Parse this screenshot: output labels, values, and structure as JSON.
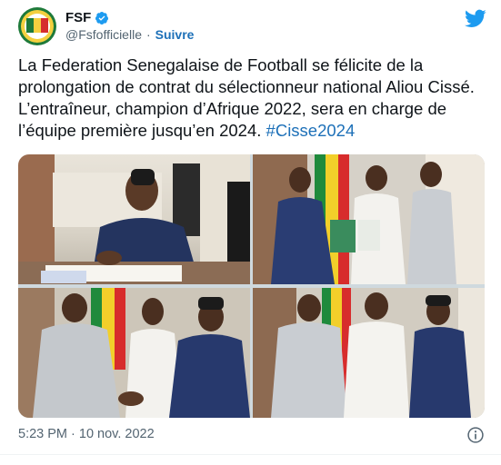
{
  "author": {
    "display_name": "FSF",
    "handle": "@Fsfofficielle",
    "separator": "·",
    "follow_label": "Suivre"
  },
  "tweet": {
    "text_main": "La Federation Senegalaise de Football se félicite de la prolongation de contrat du sélectionneur national Aliou Cissé. L’entraîneur, champion d’Afrique 2022, sera en charge de l’équipe première jusqu’en 2024. ",
    "hashtag": "#Cisse2024",
    "timestamp": "5:23 PM · 10 nov. 2022"
  },
  "colors": {
    "link": "#1d70b8",
    "twitter_blue": "#1d9bf0",
    "text_secondary": "#536471"
  },
  "icons": [
    "verified-badge-icon",
    "twitter-bird-icon",
    "info-icon"
  ]
}
